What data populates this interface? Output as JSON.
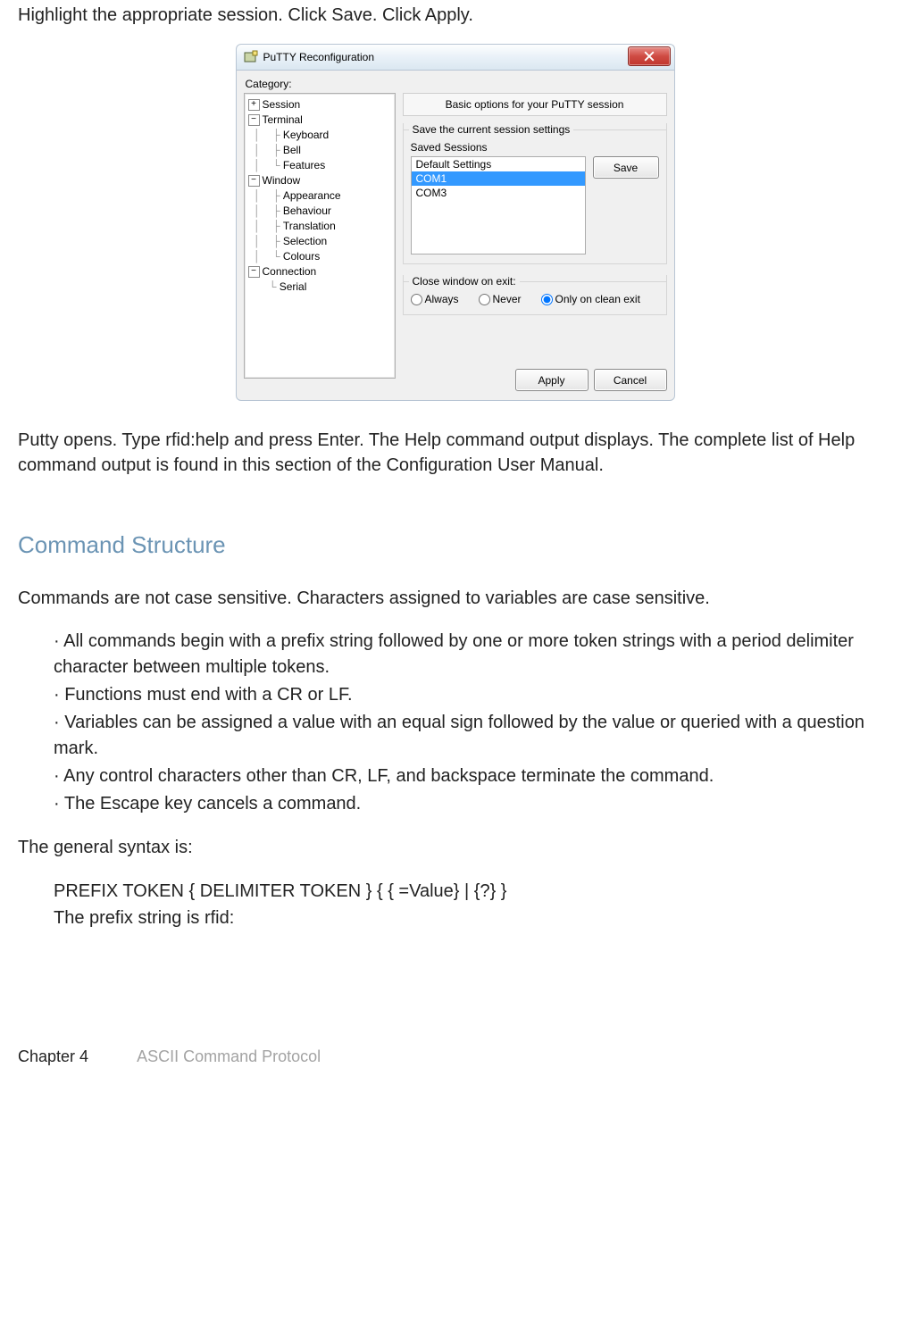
{
  "doc": {
    "intro": "Highlight the appropriate  session. Click Save. Click Apply.",
    "after_image": "Putty opens. Type rfid:help and press Enter. The Help command output displays. The complete list of Help command output is found in this section of the Configuration User Manual.",
    "heading": "Command Structure",
    "cs_intro": "Commands are not case sensitive. Characters assigned to variables are case sensitive.",
    "bullets": {
      "b1": "· All commands begin with a prefix string followed by one or more token strings with a period delimiter character between multiple tokens.",
      "b2": "· Functions must end with a CR or LF.",
      "b3": "· Variables can be assigned a value with an equal sign followed by the value or queried with a question mark.",
      "b4": "· Any control characters other than CR, LF, and backspace terminate the command.",
      "b5": "· The Escape key cancels a command."
    },
    "syntax_intro": "The general syntax is:",
    "syntax_line": "PREFIX TOKEN  { DELIMITER TOKEN } { { =Value} | {?}  }",
    "prefix_line": "The prefix string is rfid:",
    "footer_chapter": "Chapter 4",
    "footer_section": "ASCII Command Protocol"
  },
  "putty": {
    "title": "PuTTY Reconfiguration",
    "category_label": "Category:",
    "tree": {
      "session": "Session",
      "terminal": "Terminal",
      "keyboard": "Keyboard",
      "bell": "Bell",
      "features": "Features",
      "window": "Window",
      "appearance": "Appearance",
      "behaviour": "Behaviour",
      "translation": "Translation",
      "selection": "Selection",
      "colours": "Colours",
      "connection": "Connection",
      "serial": "Serial"
    },
    "panel_title": "Basic options for your PuTTY session",
    "group_save_title": "Save the current session settings",
    "saved_sessions_label": "Saved Sessions",
    "sessions": {
      "s0": "Default Settings",
      "s1": "COM1",
      "s2": "COM3"
    },
    "save_btn": "Save",
    "close_group_title": "Close window on exit:",
    "radio_always": "Always",
    "radio_never": "Never",
    "radio_clean": "Only on clean exit",
    "apply_btn": "Apply",
    "cancel_btn": "Cancel"
  }
}
